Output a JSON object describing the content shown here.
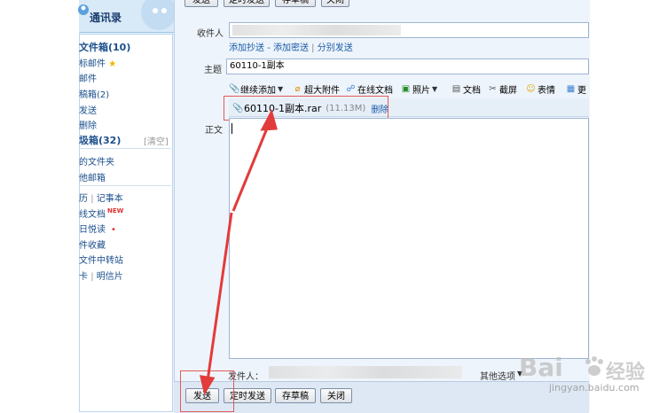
{
  "sidebar": {
    "contacts_label": "通讯录",
    "items": [
      {
        "label": "文件箱(10)",
        "bold": true
      },
      {
        "label": "标邮件",
        "star": "★"
      },
      {
        "label": "邮件"
      },
      {
        "label": "稿箱(2)"
      },
      {
        "label": "发送"
      },
      {
        "label": "删除"
      },
      {
        "label": "圾箱(32)",
        "bold": true,
        "extra": "[清空]"
      },
      {
        "label": "的文件夹"
      },
      {
        "label": "他邮箱"
      },
      {
        "label": "历",
        "sep": "|",
        "label2": "记事本"
      },
      {
        "label": "线文档",
        "badge": "NEW"
      },
      {
        "label": "日悦读",
        "dot": "•"
      },
      {
        "label": "件收藏"
      },
      {
        "label": "文件中转站"
      },
      {
        "label": "卡",
        "sep": "|",
        "label2": "明信片"
      }
    ]
  },
  "top_toolbar": {
    "send": "发送",
    "scheduled": "定时发送",
    "draft": "存草稿",
    "close": "关闭"
  },
  "compose": {
    "to_label": "收件人",
    "to_links": {
      "cc": "添加抄送",
      "dash": "-",
      "bcc": "添加密送",
      "pipe": "|",
      "separate": "分别发送"
    },
    "subject_label": "主题",
    "subject_value": "60110-1副本",
    "tools": {
      "continue_add": "继续添加",
      "super_attach": "超大附件",
      "online_doc": "在线文档",
      "photo": "照片",
      "doc": "文档",
      "screenshot": "截屏",
      "emoji": "表情",
      "more": "更"
    },
    "attachment": {
      "name": "60110-1副本.rar",
      "size": "(11.13M)",
      "delete": "删除"
    },
    "body_label": "正文",
    "sender_label": "发件人：",
    "other_options": "其他选项"
  },
  "bottom_toolbar": {
    "send": "发送",
    "scheduled": "定时发送",
    "draft": "存草稿",
    "close": "关闭"
  },
  "watermark": {
    "brand": "Bai",
    "brand2": "经验",
    "url": "jingyan.baidu.com"
  },
  "colors": {
    "accent": "#1a5ba8",
    "highlight": "#e25a5a",
    "sidebar_bg": "#eaf3fb"
  }
}
